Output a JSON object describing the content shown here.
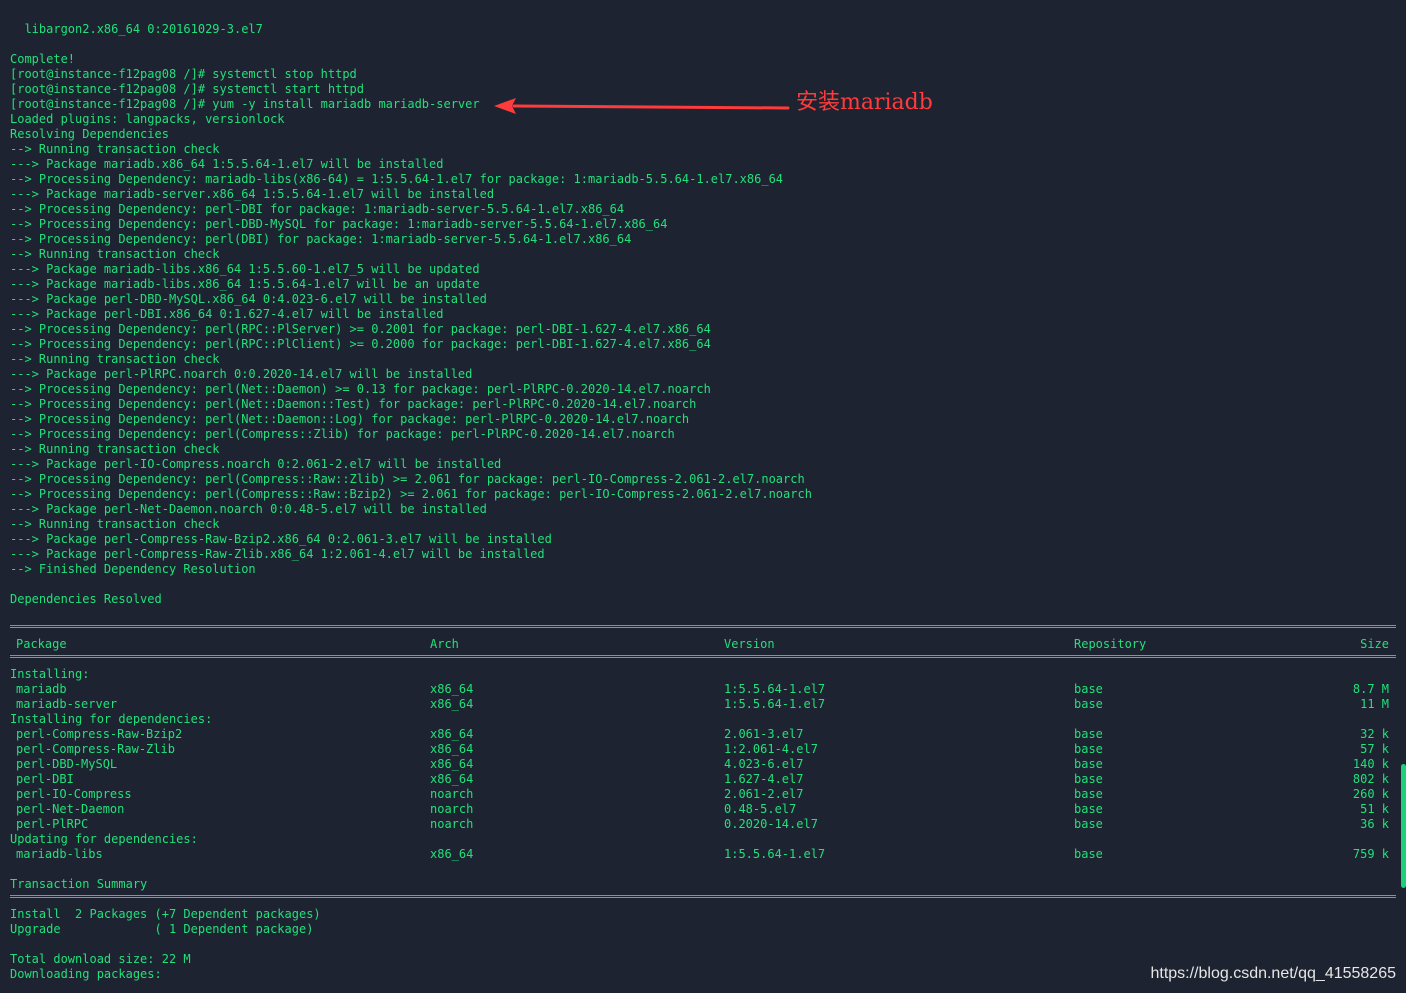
{
  "lines": [
    {
      "t": "  libargon2.x86_64 0:20161029-3.el7"
    },
    {
      "t": ""
    },
    {
      "t": "Complete!"
    },
    {
      "t": "[root@instance-f12pag08 /]# systemctl stop httpd"
    },
    {
      "t": "[root@instance-f12pag08 /]# systemctl start httpd"
    },
    {
      "t": "[root@instance-f12pag08 /]# yum -y install mariadb mariadb-server"
    },
    {
      "t": "Loaded plugins: langpacks, versionlock"
    },
    {
      "t": "Resolving Dependencies"
    },
    {
      "t": "--> Running transaction check"
    },
    {
      "t": "---> Package mariadb.x86_64 1:5.5.64-1.el7 will be installed"
    },
    {
      "t": "--> Processing Dependency: mariadb-libs(x86-64) = 1:5.5.64-1.el7 for package: 1:mariadb-5.5.64-1.el7.x86_64"
    },
    {
      "t": "---> Package mariadb-server.x86_64 1:5.5.64-1.el7 will be installed"
    },
    {
      "t": "--> Processing Dependency: perl-DBI for package: 1:mariadb-server-5.5.64-1.el7.x86_64"
    },
    {
      "t": "--> Processing Dependency: perl-DBD-MySQL for package: 1:mariadb-server-5.5.64-1.el7.x86_64"
    },
    {
      "t": "--> Processing Dependency: perl(DBI) for package: 1:mariadb-server-5.5.64-1.el7.x86_64"
    },
    {
      "t": "--> Running transaction check"
    },
    {
      "t": "---> Package mariadb-libs.x86_64 1:5.5.60-1.el7_5 will be updated"
    },
    {
      "t": "---> Package mariadb-libs.x86_64 1:5.5.64-1.el7 will be an update"
    },
    {
      "t": "---> Package perl-DBD-MySQL.x86_64 0:4.023-6.el7 will be installed"
    },
    {
      "t": "---> Package perl-DBI.x86_64 0:1.627-4.el7 will be installed"
    },
    {
      "t": "--> Processing Dependency: perl(RPC::PlServer) >= 0.2001 for package: perl-DBI-1.627-4.el7.x86_64"
    },
    {
      "t": "--> Processing Dependency: perl(RPC::PlClient) >= 0.2000 for package: perl-DBI-1.627-4.el7.x86_64"
    },
    {
      "t": "--> Running transaction check"
    },
    {
      "t": "---> Package perl-PlRPC.noarch 0:0.2020-14.el7 will be installed"
    },
    {
      "t": "--> Processing Dependency: perl(Net::Daemon) >= 0.13 for package: perl-PlRPC-0.2020-14.el7.noarch"
    },
    {
      "t": "--> Processing Dependency: perl(Net::Daemon::Test) for package: perl-PlRPC-0.2020-14.el7.noarch"
    },
    {
      "t": "--> Processing Dependency: perl(Net::Daemon::Log) for package: perl-PlRPC-0.2020-14.el7.noarch"
    },
    {
      "t": "--> Processing Dependency: perl(Compress::Zlib) for package: perl-PlRPC-0.2020-14.el7.noarch"
    },
    {
      "t": "--> Running transaction check"
    },
    {
      "t": "---> Package perl-IO-Compress.noarch 0:2.061-2.el7 will be installed"
    },
    {
      "t": "--> Processing Dependency: perl(Compress::Raw::Zlib) >= 2.061 for package: perl-IO-Compress-2.061-2.el7.noarch"
    },
    {
      "t": "--> Processing Dependency: perl(Compress::Raw::Bzip2) >= 2.061 for package: perl-IO-Compress-2.061-2.el7.noarch"
    },
    {
      "t": "---> Package perl-Net-Daemon.noarch 0:0.48-5.el7 will be installed"
    },
    {
      "t": "--> Running transaction check"
    },
    {
      "t": "---> Package perl-Compress-Raw-Bzip2.x86_64 0:2.061-3.el7 will be installed"
    },
    {
      "t": "---> Package perl-Compress-Raw-Zlib.x86_64 1:2.061-4.el7 will be installed"
    },
    {
      "t": "--> Finished Dependency Resolution"
    },
    {
      "t": ""
    },
    {
      "t": "Dependencies Resolved"
    },
    {
      "t": ""
    },
    {
      "rule": true
    },
    {
      "row": [
        "Package",
        "Arch",
        "Version",
        "Repository",
        "Size"
      ]
    },
    {
      "rule": true
    },
    {
      "t": "Installing:"
    },
    {
      "row": [
        "mariadb",
        "x86_64",
        "1:5.5.64-1.el7",
        "base",
        "8.7 M"
      ]
    },
    {
      "row": [
        "mariadb-server",
        "x86_64",
        "1:5.5.64-1.el7",
        "base",
        "11 M"
      ]
    },
    {
      "t": "Installing for dependencies:"
    },
    {
      "row": [
        "perl-Compress-Raw-Bzip2",
        "x86_64",
        "2.061-3.el7",
        "base",
        "32 k"
      ]
    },
    {
      "row": [
        "perl-Compress-Raw-Zlib",
        "x86_64",
        "1:2.061-4.el7",
        "base",
        "57 k"
      ]
    },
    {
      "row": [
        "perl-DBD-MySQL",
        "x86_64",
        "4.023-6.el7",
        "base",
        "140 k"
      ]
    },
    {
      "row": [
        "perl-DBI",
        "x86_64",
        "1.627-4.el7",
        "base",
        "802 k"
      ]
    },
    {
      "row": [
        "perl-IO-Compress",
        "noarch",
        "2.061-2.el7",
        "base",
        "260 k"
      ]
    },
    {
      "row": [
        "perl-Net-Daemon",
        "noarch",
        "0.48-5.el7",
        "base",
        "51 k"
      ]
    },
    {
      "row": [
        "perl-PlRPC",
        "noarch",
        "0.2020-14.el7",
        "base",
        "36 k"
      ]
    },
    {
      "t": "Updating for dependencies:"
    },
    {
      "row": [
        "mariadb-libs",
        "x86_64",
        "1:5.5.64-1.el7",
        "base",
        "759 k"
      ]
    },
    {
      "t": ""
    },
    {
      "t": "Transaction Summary"
    },
    {
      "rule": true
    },
    {
      "t": "Install  2 Packages (+7 Dependent packages)"
    },
    {
      "t": "Upgrade             ( 1 Dependent package)"
    },
    {
      "t": ""
    },
    {
      "t": "Total download size: 22 M"
    },
    {
      "t": "Downloading packages:"
    }
  ],
  "annotation": {
    "label": "安装mariadb",
    "color": "#ff3b3b"
  },
  "watermark": "https://blog.csdn.net/qq_41558265",
  "colors": {
    "background": "#1d2330",
    "text": "#22e07a",
    "scrollbar": "#1fd07a"
  }
}
